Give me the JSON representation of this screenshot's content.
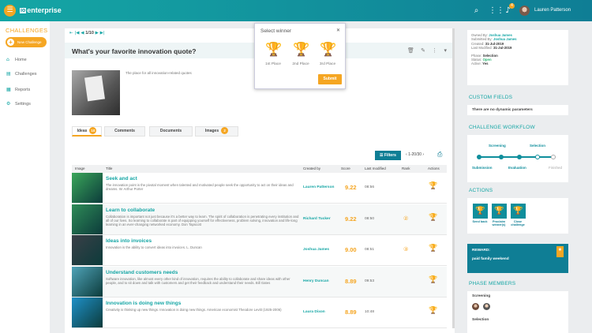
{
  "topbar": {
    "app_name": "enterprise",
    "logo_prefix": "io",
    "notification_count": "4",
    "user_name": "Lauren Patterson"
  },
  "sidebar": {
    "title": "CHALLENGES",
    "new_button": "New Challenge",
    "items": [
      {
        "label": "Home",
        "icon": "home-icon"
      },
      {
        "label": "Challenges",
        "icon": "challenges-icon"
      },
      {
        "label": "Reports",
        "icon": "reports-icon"
      },
      {
        "label": "Settings",
        "icon": "settings-icon"
      }
    ]
  },
  "main": {
    "pager": "1/10",
    "title": "What's your favorite innovation quote?",
    "description": "The place for all innovation-related quotes",
    "tabs": [
      {
        "label": "Ideas",
        "count": "10"
      },
      {
        "label": "Comments",
        "count": ""
      },
      {
        "label": "Documents",
        "count": ""
      },
      {
        "label": "Images",
        "count": "2"
      }
    ],
    "filters_label": "Filters",
    "page_count": "1-20/30",
    "columns": [
      "Image",
      "Title",
      "Created by",
      "Score",
      "Last modified",
      "Rank",
      "Actions"
    ],
    "rows": [
      {
        "title": "Seek and act",
        "desc": "The innovation point is the pivotal moment when talented and motivated people seek the opportunity to act on their ideas and dreams. W. Arthur Porter",
        "author": "Lauren Patterson",
        "score": "9.22",
        "time": "08:56",
        "rank": "",
        "color": "#3aa65a"
      },
      {
        "title": "Learn to collaborate",
        "desc": "Collaboration is important not just because it's a better way to learn. The spirit of collaboration is penetrating every institution and all of our lives. So learning to collaborate is part of equipping yourself for effectiveness, problem solving, innovation and life-long learning in an ever-changing networked economy. Don Tapscott",
        "author": "Richard Tucker",
        "score": "9.22",
        "time": "08:50",
        "rank": "②",
        "color": "#2e8b57"
      },
      {
        "title": "Ideas into invoices",
        "desc": "Innovation is the ability to convert ideas into invoices. L. Duncan",
        "author": "Joshua James",
        "score": "9.00",
        "time": "08:51",
        "rank": "③",
        "color": "#3a3f47"
      },
      {
        "title": "Understand customers needs",
        "desc": "Software innovation, like almost every other kind of innovation, requires the ability to collaborate and share ideas with other people, and to sit down and talk with customers and get their feedback and understand their needs. Bill Gates",
        "author": "Henry Duncan",
        "score": "8.89",
        "time": "09:53",
        "rank": "",
        "color": "#4fa3b8"
      },
      {
        "title": "Innovation is doing new things",
        "desc": "Creativity is thinking up new things. Innovation is doing new things. American economist Theodore Levitt (1925-2006)",
        "author": "Laura Dixon",
        "score": "8.89",
        "time": "10:48",
        "rank": "",
        "color": "#1e90c8"
      }
    ]
  },
  "modal": {
    "title": "Select winner",
    "places": [
      "1st Place",
      "2nd Place",
      "3rd Place"
    ],
    "submit": "Submit"
  },
  "right": {
    "info": {
      "owned_label": "Owned By:",
      "owned": "Joshua James",
      "submitted_label": "Submitted By:",
      "submitted": "Joshua James",
      "created_label": "Created:",
      "created": "31-Jul-2019",
      "modified_label": "Last Modified:",
      "modified": "31-Jul-2019",
      "phase_label": "Phase:",
      "phase": "Selection",
      "status_label": "Status:",
      "status": "Open",
      "active_label": "Active:",
      "active": "Yes"
    },
    "custom_fields_title": "CUSTOM FIELDS",
    "custom_fields_text": "There are no dynamic parameters",
    "workflow_title": "CHALLENGE WORKFLOW",
    "workflow": {
      "screening": "Screening",
      "selection": "Selection",
      "submission": "Submission",
      "evaluation": "Evaluation",
      "finished": "Finished"
    },
    "actions_title": "ACTIONS",
    "actions": [
      {
        "label": "Send back",
        "icon": "send-back-icon"
      },
      {
        "label": "Proclaim winner(s)",
        "icon": "trophy-icon"
      },
      {
        "label": "Close challenge",
        "icon": "close-challenge-icon"
      }
    ],
    "reward_label": "REWARD:",
    "reward_text": "paid family weekend",
    "members_title": "PHASE MEMBERS",
    "members_screening": "Screening",
    "members_selection": "Selection"
  }
}
